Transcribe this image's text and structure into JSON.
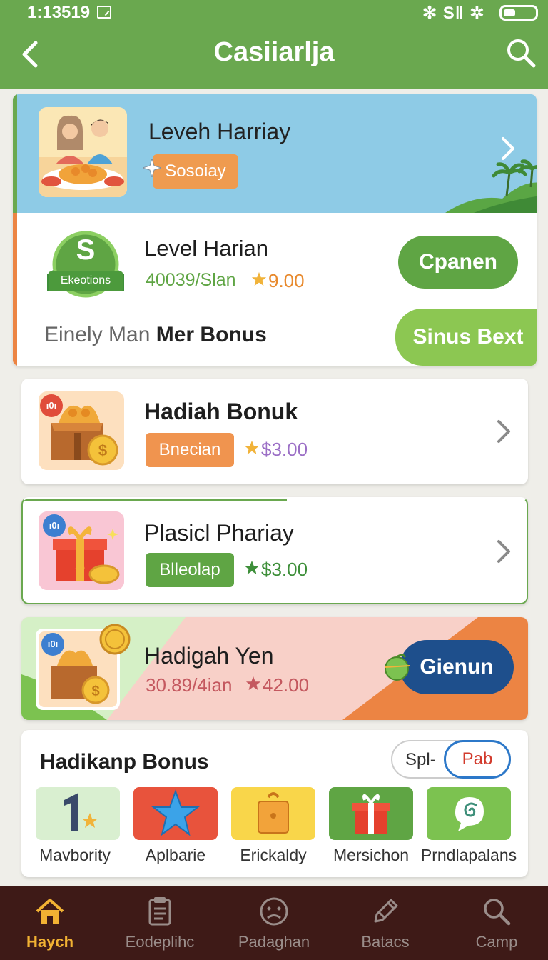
{
  "status_bar": {
    "time": "1:13519",
    "system_icons": "✻ S‖ ✲"
  },
  "header": {
    "title": "Casiiarlja",
    "back_icon": "chevron-left-icon",
    "search_icon": "search-icon"
  },
  "featured": {
    "title": "Leveh Harriay",
    "tag": "Sosoiay",
    "level": {
      "badge_letter": "S",
      "badge_text": "Ekeotions",
      "title": "Level Harian",
      "progress": "40039/Slan",
      "reward": "9.00",
      "open_label": "Cpanen"
    },
    "bonus_text_light": "Einely Man",
    "bonus_text_bold": "Mer Bonus",
    "next_label": "Sinus Bext"
  },
  "offers": [
    {
      "title": "Hadiah Bonuk",
      "tag": "Bnecian",
      "price": "$3.00",
      "badge": "ı0ı",
      "tag_color": "#f0944f"
    },
    {
      "title": "Plasicl Phariay",
      "tag": "Blleolap",
      "price": "$3.00",
      "badge": "ı0ı",
      "tag_color": "#5fa544"
    }
  ],
  "promo": {
    "title": "Hadigah Yen",
    "progress": "30.89/4ian",
    "reward": "42.00",
    "badge": "ı0ı",
    "button": "Gienun"
  },
  "bonus_section": {
    "title": "Hadikanp Bonus",
    "toggle_off": "Spl-",
    "toggle_on": "Pab",
    "categories": [
      {
        "label": "Mavbority",
        "icon": "trophy-number-icon",
        "color": "#d9efd0"
      },
      {
        "label": "Aplbarie",
        "icon": "star-icon",
        "color": "#e8533c"
      },
      {
        "label": "Erickaldy",
        "icon": "lock-box-icon",
        "color": "#f9d64a"
      },
      {
        "label": "Mersichon",
        "icon": "gift-icon",
        "color": "#5fa544"
      },
      {
        "label": "Prndlapalans",
        "icon": "spiral-chat-icon",
        "color": "#7cc250"
      }
    ]
  },
  "bottom_nav": [
    {
      "label": "Haych",
      "icon": "home-icon",
      "active": true
    },
    {
      "label": "Eodeplihc",
      "icon": "document-icon",
      "active": false
    },
    {
      "label": "Padaghan",
      "icon": "face-icon",
      "active": false
    },
    {
      "label": "Batacs",
      "icon": "pencil-icon",
      "active": false
    },
    {
      "label": "Camp",
      "icon": "search-icon",
      "active": false
    }
  ]
}
